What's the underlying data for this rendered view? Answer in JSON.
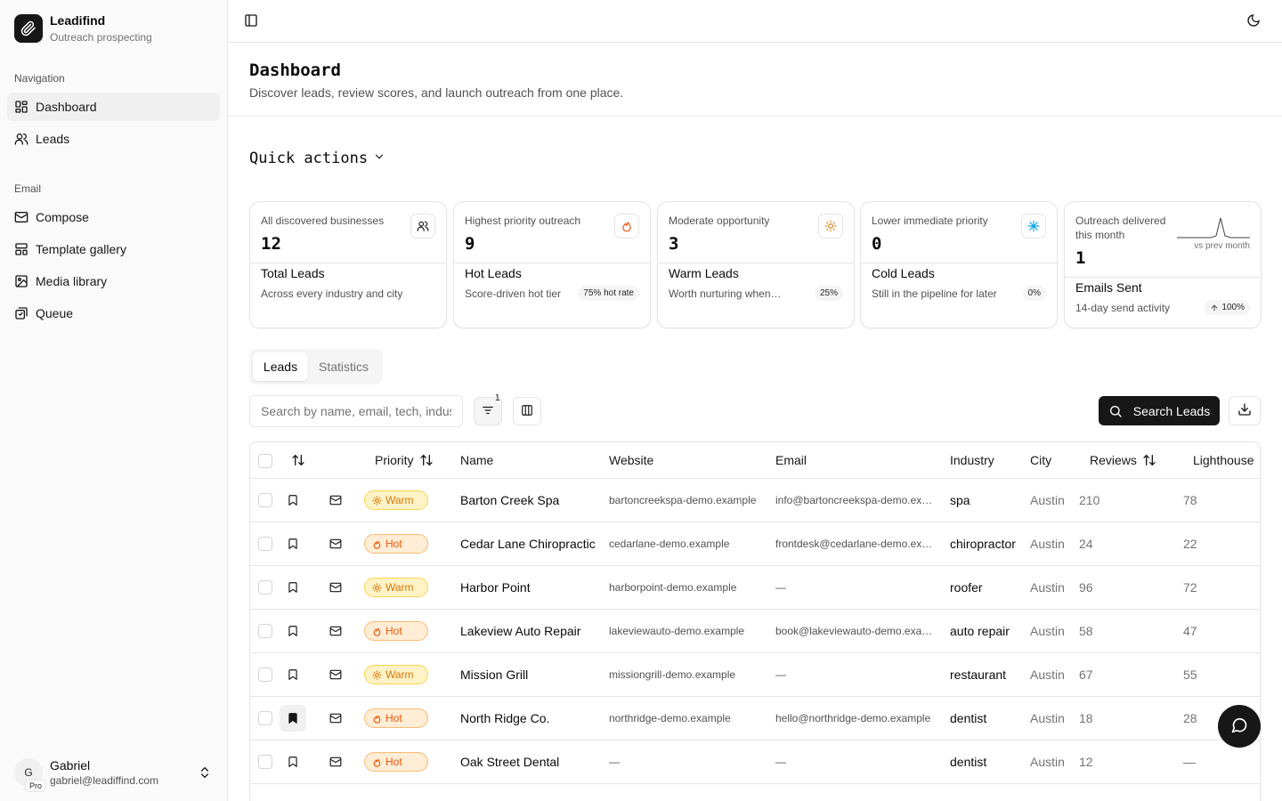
{
  "app": {
    "name": "Leadifind",
    "tagline": "Outreach prospecting"
  },
  "sidebar": {
    "groups": [
      {
        "label": "Navigation",
        "items": [
          {
            "label": "Dashboard",
            "icon": "dashboard-icon",
            "active": true
          },
          {
            "label": "Leads",
            "icon": "users-icon"
          }
        ]
      },
      {
        "label": "Email",
        "items": [
          {
            "label": "Compose",
            "icon": "mail-icon"
          },
          {
            "label": "Template gallery",
            "icon": "template-icon"
          },
          {
            "label": "Media library",
            "icon": "image-icon"
          },
          {
            "label": "Queue",
            "icon": "queue-icon"
          }
        ]
      }
    ],
    "user": {
      "initial": "G",
      "plan": "Pro",
      "name": "Gabriel",
      "email": "gabriel@leadiffind.com"
    }
  },
  "page": {
    "title": "Dashboard",
    "subtitle": "Discover leads, review scores, and launch outreach from one place.",
    "quick_actions_label": "Quick actions"
  },
  "stats": [
    {
      "desc": "All discovered businesses",
      "value": "12",
      "title": "Total Leads",
      "foot": "Across every industry and city",
      "pill": "",
      "icon": "users-icon"
    },
    {
      "desc": "Highest priority outreach",
      "value": "9",
      "title": "Hot Leads",
      "foot": "Score-driven hot tier",
      "pill": "75% hot rate",
      "icon": "flame-icon"
    },
    {
      "desc": "Moderate opportunity",
      "value": "3",
      "title": "Warm Leads",
      "foot": "Worth nurturing when…",
      "pill": "25%",
      "icon": "sun-icon"
    },
    {
      "desc": "Lower immediate priority",
      "value": "0",
      "title": "Cold Leads",
      "foot": "Still in the pipeline for later",
      "pill": "0%",
      "icon": "snowflake-icon"
    },
    {
      "desc": "Outreach delivered this month",
      "value": "1",
      "title": "Emails Sent",
      "foot": "14-day send activity",
      "pill": "100%",
      "spark_label": "vs prev month",
      "icon": "sparkline-icon"
    }
  ],
  "tabs": [
    {
      "label": "Leads",
      "active": true
    },
    {
      "label": "Statistics",
      "active": false
    }
  ],
  "toolbar": {
    "search_placeholder": "Search by name, email, tech, industry",
    "filter_count": "1",
    "search_button": "Search Leads"
  },
  "table": {
    "columns": [
      "Priority",
      "Name",
      "Website",
      "Email",
      "Industry",
      "City",
      "Reviews",
      "Lighthouse"
    ],
    "rows": [
      {
        "priority": "Warm",
        "name": "Barton Creek Spa",
        "website": "bartoncreekspa-demo.example",
        "email": "info@bartoncreekspa-demo.example",
        "industry": "spa",
        "city": "Austin",
        "reviews": "210",
        "lighthouse": "78",
        "saved": false
      },
      {
        "priority": "Hot",
        "name": "Cedar Lane Chiropractic",
        "website": "cedarlane-demo.example",
        "email": "frontdesk@cedarlane-demo.example",
        "industry": "chiropractor",
        "city": "Austin",
        "reviews": "24",
        "lighthouse": "22",
        "saved": false
      },
      {
        "priority": "Warm",
        "name": "Harbor Point",
        "website": "harborpoint-demo.example",
        "email": "—",
        "industry": "roofer",
        "city": "Austin",
        "reviews": "96",
        "lighthouse": "72",
        "saved": false
      },
      {
        "priority": "Hot",
        "name": "Lakeview Auto Repair",
        "website": "lakeviewauto-demo.example",
        "email": "book@lakeviewauto-demo.example",
        "industry": "auto repair",
        "city": "Austin",
        "reviews": "58",
        "lighthouse": "47",
        "saved": false
      },
      {
        "priority": "Warm",
        "name": "Mission Grill",
        "website": "missiongrill-demo.example",
        "email": "—",
        "industry": "restaurant",
        "city": "Austin",
        "reviews": "67",
        "lighthouse": "55",
        "saved": false
      },
      {
        "priority": "Hot",
        "name": "North Ridge Co.",
        "website": "northridge-demo.example",
        "email": "hello@northridge-demo.example",
        "industry": "dentist",
        "city": "Austin",
        "reviews": "18",
        "lighthouse": "28",
        "saved": true
      },
      {
        "priority": "Hot",
        "name": "Oak Street Dental",
        "website": "—",
        "email": "—",
        "industry": "dentist",
        "city": "Austin",
        "reviews": "12",
        "lighthouse": "—",
        "saved": false
      }
    ]
  },
  "colors": {
    "warm": "#d97706",
    "hot": "#ea580c",
    "cold": "#0ea5e9",
    "primary": "#171717"
  }
}
